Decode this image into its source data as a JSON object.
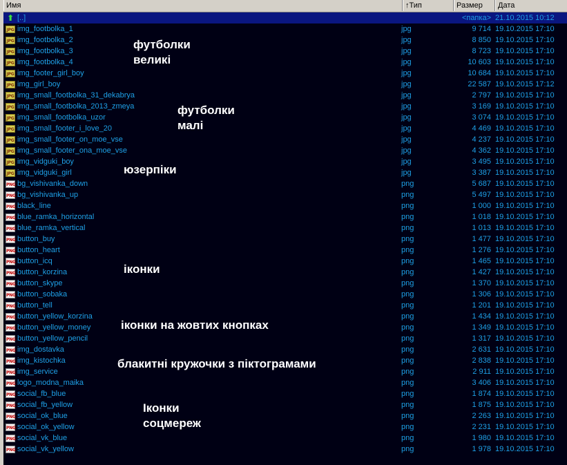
{
  "columns": {
    "name": "Имя",
    "type": "↑Тип",
    "size": "Размер",
    "date": "Дата"
  },
  "up_row": {
    "name": "[..]",
    "size": "<папка>",
    "date": "21.10.2015 10:12"
  },
  "files": [
    {
      "name": "img_footbolka_1",
      "type": "jpg",
      "size": "9 714",
      "date": "19.10.2015 17:10"
    },
    {
      "name": "img_footbolka_2",
      "type": "jpg",
      "size": "8 850",
      "date": "19.10.2015 17:10"
    },
    {
      "name": "img_footbolka_3",
      "type": "jpg",
      "size": "8 723",
      "date": "19.10.2015 17:10"
    },
    {
      "name": "img_footbolka_4",
      "type": "jpg",
      "size": "10 603",
      "date": "19.10.2015 17:10"
    },
    {
      "name": "img_footer_girl_boy",
      "type": "jpg",
      "size": "10 684",
      "date": "19.10.2015 17:10"
    },
    {
      "name": "img_girl_boy",
      "type": "jpg",
      "size": "22 587",
      "date": "19.10.2015 17:12"
    },
    {
      "name": "img_small_footbolka_31_dekabrya",
      "type": "jpg",
      "size": "2 797",
      "date": "19.10.2015 17:10"
    },
    {
      "name": "img_small_footbolka_2013_zmeya",
      "type": "jpg",
      "size": "3 169",
      "date": "19.10.2015 17:10"
    },
    {
      "name": "img_small_footbolka_uzor",
      "type": "jpg",
      "size": "3 074",
      "date": "19.10.2015 17:10"
    },
    {
      "name": "img_small_footer_i_love_20",
      "type": "jpg",
      "size": "4 469",
      "date": "19.10.2015 17:10"
    },
    {
      "name": "img_small_footer_on_moe_vse",
      "type": "jpg",
      "size": "4 237",
      "date": "19.10.2015 17:10"
    },
    {
      "name": "img_small_footer_ona_moe_vse",
      "type": "jpg",
      "size": "4 362",
      "date": "19.10.2015 17:10"
    },
    {
      "name": "img_vidguki_boy",
      "type": "jpg",
      "size": "3 495",
      "date": "19.10.2015 17:10"
    },
    {
      "name": "img_vidguki_girl",
      "type": "jpg",
      "size": "3 387",
      "date": "19.10.2015 17:10"
    },
    {
      "name": "bg_vishivanka_down",
      "type": "png",
      "size": "5 687",
      "date": "19.10.2015 17:10"
    },
    {
      "name": "bg_vishivanka_up",
      "type": "png",
      "size": "5 497",
      "date": "19.10.2015 17:10"
    },
    {
      "name": "black_line",
      "type": "png",
      "size": "1 000",
      "date": "19.10.2015 17:10"
    },
    {
      "name": "blue_ramka_horizontal",
      "type": "png",
      "size": "1 018",
      "date": "19.10.2015 17:10"
    },
    {
      "name": "blue_ramka_vertical",
      "type": "png",
      "size": "1 013",
      "date": "19.10.2015 17:10"
    },
    {
      "name": "button_buy",
      "type": "png",
      "size": "1 477",
      "date": "19.10.2015 17:10"
    },
    {
      "name": "button_heart",
      "type": "png",
      "size": "1 276",
      "date": "19.10.2015 17:10"
    },
    {
      "name": "button_icq",
      "type": "png",
      "size": "1 465",
      "date": "19.10.2015 17:10"
    },
    {
      "name": "button_korzina",
      "type": "png",
      "size": "1 427",
      "date": "19.10.2015 17:10"
    },
    {
      "name": "button_skype",
      "type": "png",
      "size": "1 370",
      "date": "19.10.2015 17:10"
    },
    {
      "name": "button_sobaka",
      "type": "png",
      "size": "1 306",
      "date": "19.10.2015 17:10"
    },
    {
      "name": "button_tell",
      "type": "png",
      "size": "1 201",
      "date": "19.10.2015 17:10"
    },
    {
      "name": "button_yellow_korzina",
      "type": "png",
      "size": "1 434",
      "date": "19.10.2015 17:10"
    },
    {
      "name": "button_yellow_money",
      "type": "png",
      "size": "1 349",
      "date": "19.10.2015 17:10"
    },
    {
      "name": "button_yellow_pencil",
      "type": "png",
      "size": "1 317",
      "date": "19.10.2015 17:10"
    },
    {
      "name": "img_dostavka",
      "type": "png",
      "size": "2 631",
      "date": "19.10.2015 17:10"
    },
    {
      "name": "img_kistochka",
      "type": "png",
      "size": "2 838",
      "date": "19.10.2015 17:10"
    },
    {
      "name": "img_service",
      "type": "png",
      "size": "2 911",
      "date": "19.10.2015 17:10"
    },
    {
      "name": "logo_modna_maika",
      "type": "png",
      "size": "3 406",
      "date": "19.10.2015 17:10"
    },
    {
      "name": "social_fb_blue",
      "type": "png",
      "size": "1 874",
      "date": "19.10.2015 17:10"
    },
    {
      "name": "social_fb_yellow",
      "type": "png",
      "size": "1 875",
      "date": "19.10.2015 17:10"
    },
    {
      "name": "social_ok_blue",
      "type": "png",
      "size": "2 263",
      "date": "19.10.2015 17:10"
    },
    {
      "name": "social_ok_yellow",
      "type": "png",
      "size": "2 231",
      "date": "19.10.2015 17:10"
    },
    {
      "name": "social_vk_blue",
      "type": "png",
      "size": "1 980",
      "date": "19.10.2015 17:10"
    },
    {
      "name": "social_vk_yellow",
      "type": "png",
      "size": "1 978",
      "date": "19.10.2015 17:10"
    }
  ],
  "icon_text": {
    "jpg": "JPG",
    "png": "PNG",
    "up": "up-arrow-icon"
  },
  "annotations": [
    {
      "id": "ann-tshirts-big-1",
      "text": "футболки"
    },
    {
      "id": "ann-tshirts-big-2",
      "text": "великі"
    },
    {
      "id": "ann-tshirts-small-1",
      "text": "футболки"
    },
    {
      "id": "ann-tshirts-small-2",
      "text": "малі"
    },
    {
      "id": "ann-userpics",
      "text": "юзерпіки"
    },
    {
      "id": "ann-icons",
      "text": "іконки"
    },
    {
      "id": "ann-yellow-buttons",
      "text": "іконки на жовтих кнопках"
    },
    {
      "id": "ann-blue-circles",
      "text": "блакитні кружочки з піктограмами"
    },
    {
      "id": "ann-social-1",
      "text": "Іконки"
    },
    {
      "id": "ann-social-2",
      "text": "соцмереж"
    }
  ],
  "colors": {
    "background": "#000014",
    "file_text": "#1ea0e6",
    "annotation_text": "#ffffff",
    "up_row_bg": "#0a1680"
  }
}
